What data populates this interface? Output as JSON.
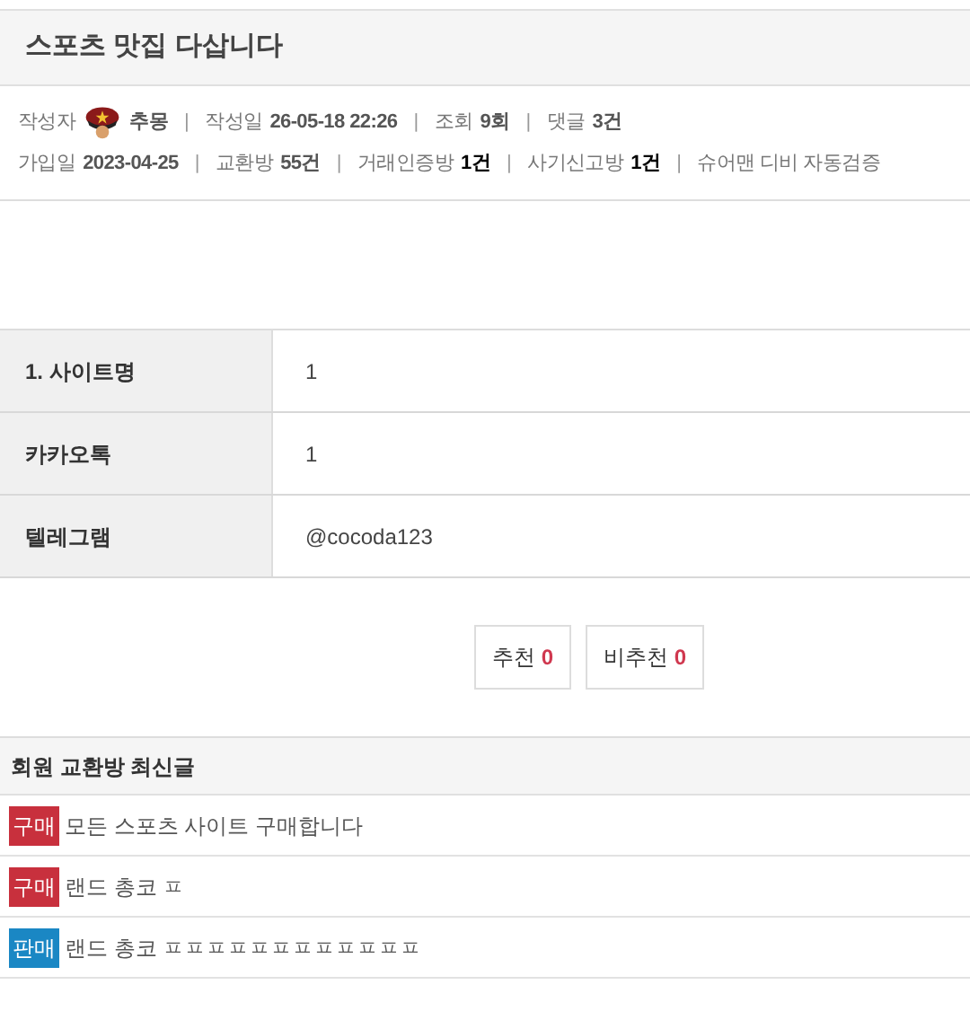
{
  "title": "스포츠 맛집 다삽니다",
  "meta_rows": [
    [
      {
        "label": "작성자",
        "value": "추몽",
        "avatar": true,
        "bold": false
      },
      {
        "sep": "|",
        "label": "작성일",
        "value": "26-05-18 22:26",
        "bold": false
      },
      {
        "sep": "|",
        "label": "조회",
        "value": "9회",
        "bold": false
      },
      {
        "sep": "|",
        "label": "댓글",
        "value": "3건",
        "bold": false
      }
    ],
    [
      {
        "label": "가입일",
        "value": "2023-04-25",
        "bold": false
      },
      {
        "sep": "|",
        "label": "교환방",
        "value": "55건",
        "bold": false
      },
      {
        "sep": "|",
        "label": "거래인증방",
        "value": "1건",
        "bold": true
      },
      {
        "sep": "|",
        "label": "사기신고방",
        "value": "1건",
        "bold": true
      },
      {
        "sep": "|",
        "label": "슈어맨 디비 자동검증"
      }
    ]
  ],
  "info_table": [
    {
      "label": "1. 사이트명",
      "value": "1"
    },
    {
      "label": "카카오톡",
      "value": "1"
    },
    {
      "label": "텔레그램",
      "value": "@cocoda123"
    }
  ],
  "votes": [
    {
      "label": "추천",
      "count": "0"
    },
    {
      "label": "비추천",
      "count": "0"
    }
  ],
  "recent": {
    "title": "회원 교환방 최신글",
    "items": [
      {
        "tag": "구매",
        "color": "#c8303d",
        "text": "모든 스포츠 사이트 구매합니다"
      },
      {
        "tag": "구매",
        "color": "#c8303d",
        "text": "랜드 총코 ㅍ"
      },
      {
        "tag": "판매",
        "color": "#1a87c4",
        "text": "랜드 총코 ㅍㅍㅍㅍㅍㅍㅍㅍㅍㅍㅍㅍ"
      }
    ]
  }
}
